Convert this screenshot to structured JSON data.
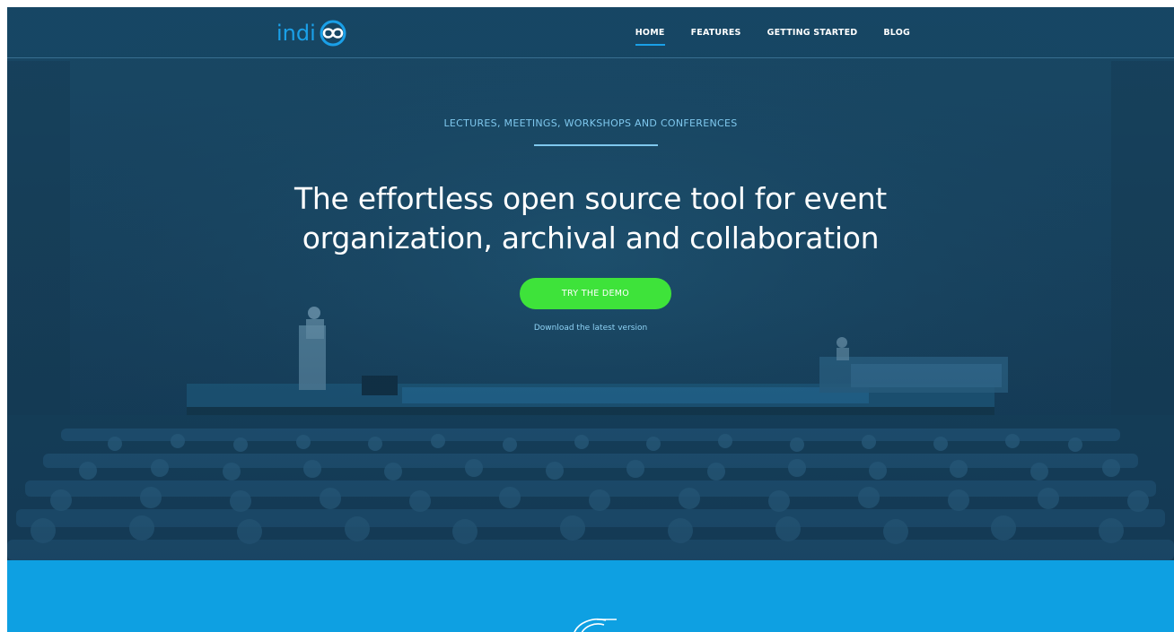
{
  "nav": {
    "logo_text": "indi",
    "links": [
      {
        "label": "HOME",
        "active": true
      },
      {
        "label": "FEATURES",
        "active": false
      },
      {
        "label": "GETTING STARTED",
        "active": false
      },
      {
        "label": "BLOG",
        "active": false
      }
    ]
  },
  "hero": {
    "kicker": "LECTURES, MEETINGS, WORKSHOPS AND CONFERENCES",
    "headline_line1": "The effortless open source tool for event",
    "headline_line2": "organization, archival and collaboration",
    "cta_label": "TRY THE DEMO",
    "download_link": "Download the latest version"
  },
  "colors": {
    "brand_blue": "#1aa0e8",
    "cta_green": "#3ee33a",
    "band_blue": "#0ea0e2",
    "hero_dark": "#17405a"
  }
}
